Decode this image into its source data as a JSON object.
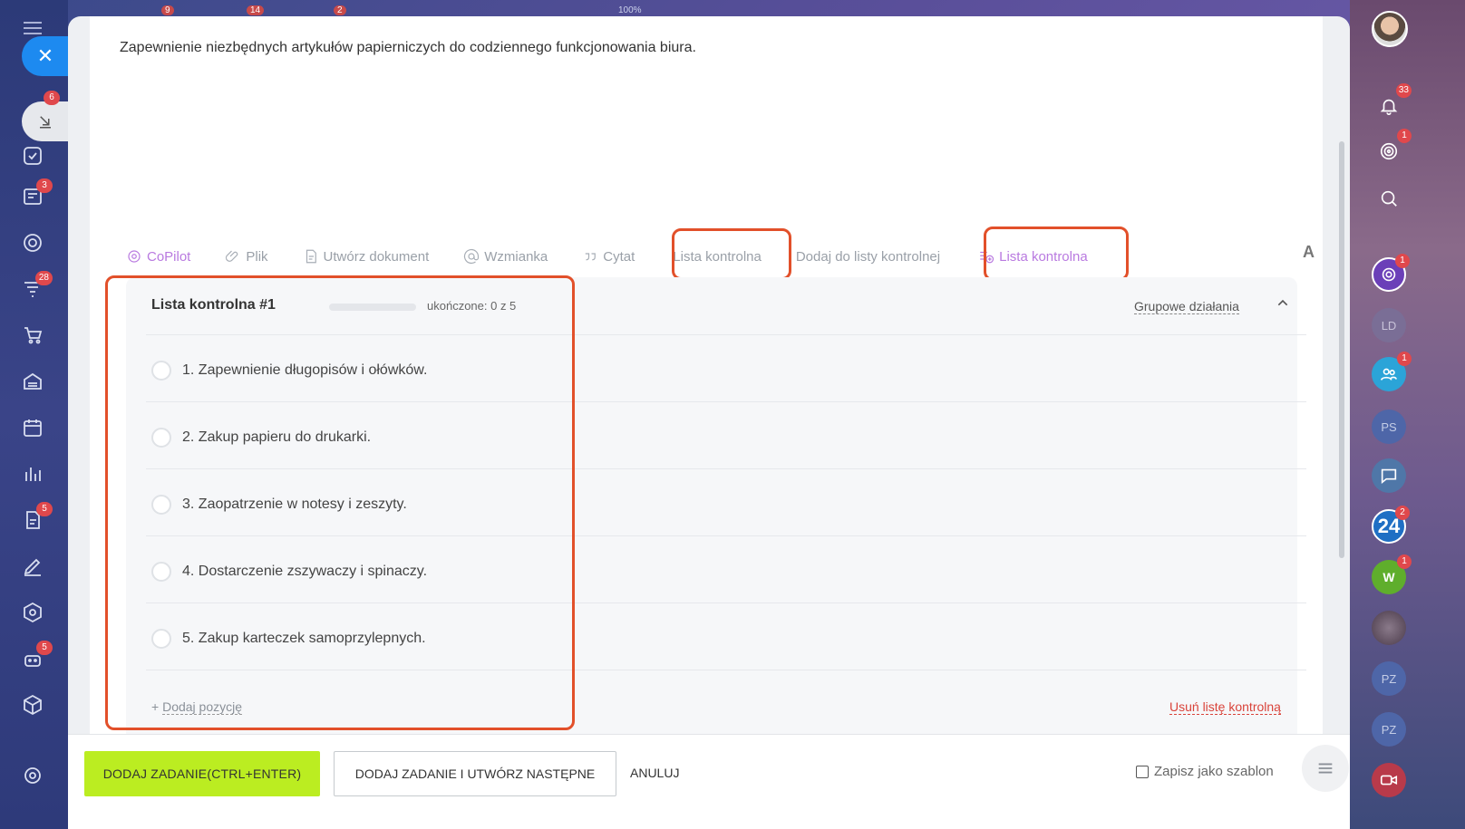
{
  "description": "Zapewnienie niezbędnych artykułów papierniczych do codziennego funkcjonowania biura.",
  "left_rail": {
    "badges": [
      "6",
      "3",
      "28",
      "5",
      "5"
    ]
  },
  "right_rail": {
    "badges": [
      "33",
      "1",
      "1",
      "1",
      "2",
      "1"
    ],
    "initials": [
      "LD",
      "PS",
      "PZ",
      "PZ",
      "W",
      "24"
    ]
  },
  "toolbar": {
    "copilot": "CoPilot",
    "file": "Plik",
    "create_doc": "Utwórz dokument",
    "mention": "Wzmianka",
    "quote": "Cytat",
    "checklist": "Lista kontrolna",
    "add_to_checklist": "Dodaj do listy kontrolnej",
    "checklist_new": "Lista kontrolna",
    "font": "A"
  },
  "checklist": {
    "title": "Lista kontrolna #1",
    "progress": 0,
    "completed_label": "ukończone: 0 z 5",
    "group_actions": "Grupowe działania",
    "items": [
      "1. Zapewnienie długopisów i ołówków.",
      "2. Zakup papieru do drukarki.",
      "3. Zaopatrzenie w notesy i zeszyty.",
      "4. Dostarczenie zszywaczy i spinaczy.",
      "5. Zakup karteczek samoprzylepnych."
    ],
    "add_item_prefix": "+",
    "add_item": "Dodaj pozycję",
    "delete": "Usuń listę kontrolną"
  },
  "footer": {
    "add_task": "DODAJ ZADANIE(CTRL+ENTER)",
    "add_and_next": "DODAJ ZADANIE I UTWÓRZ NASTĘPNE",
    "cancel": "ANULUJ",
    "save_template": "Zapisz jako szablon"
  },
  "colors": {
    "primary_button": "#bbed21",
    "highlight": "#e2502a",
    "copilot": "#b97ae0",
    "delete": "#d9433a"
  },
  "top_strip": [
    "9",
    "14",
    "2",
    "100%",
    "2",
    "14"
  ]
}
